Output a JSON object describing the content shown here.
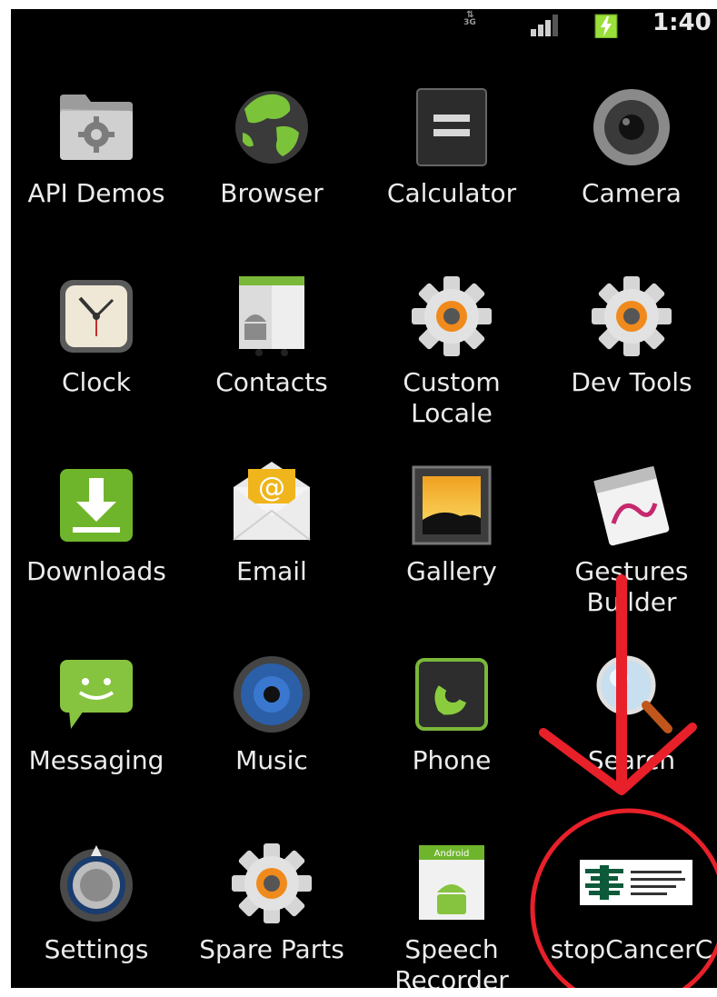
{
  "status_bar": {
    "network_type": "3G",
    "time": "1:40"
  },
  "apps": [
    {
      "label": "API Demos",
      "icon": "folder-gear-icon"
    },
    {
      "label": "Browser",
      "icon": "globe-icon"
    },
    {
      "label": "Calculator",
      "icon": "calculator-icon"
    },
    {
      "label": "Camera",
      "icon": "camera-lens-icon"
    },
    {
      "label": "Clock",
      "icon": "clock-icon"
    },
    {
      "label": "Contacts",
      "icon": "contacts-android-icon"
    },
    {
      "label": "Custom\nLocale",
      "icon": "gear-icon"
    },
    {
      "label": "Dev Tools",
      "icon": "gear-icon"
    },
    {
      "label": "Downloads",
      "icon": "download-icon"
    },
    {
      "label": "Email",
      "icon": "envelope-at-icon"
    },
    {
      "label": "Gallery",
      "icon": "picture-frame-icon"
    },
    {
      "label": "Gestures\nBuilder",
      "icon": "gesture-pad-icon"
    },
    {
      "label": "Messaging",
      "icon": "chat-bubble-icon"
    },
    {
      "label": "Music",
      "icon": "speaker-icon"
    },
    {
      "label": "Phone",
      "icon": "phone-handset-icon"
    },
    {
      "label": "Search",
      "icon": "magnifier-icon"
    },
    {
      "label": "Settings",
      "icon": "settings-knob-icon"
    },
    {
      "label": "Spare Parts",
      "icon": "gear-icon"
    },
    {
      "label": "Speech\nRecorder",
      "icon": "android-recorder-icon"
    },
    {
      "label": "stopCancerC",
      "icon": "stopcancer-logo-icon"
    }
  ],
  "annotation": {
    "arrow_color": "#e8202a",
    "circle_color": "#e8202a"
  }
}
